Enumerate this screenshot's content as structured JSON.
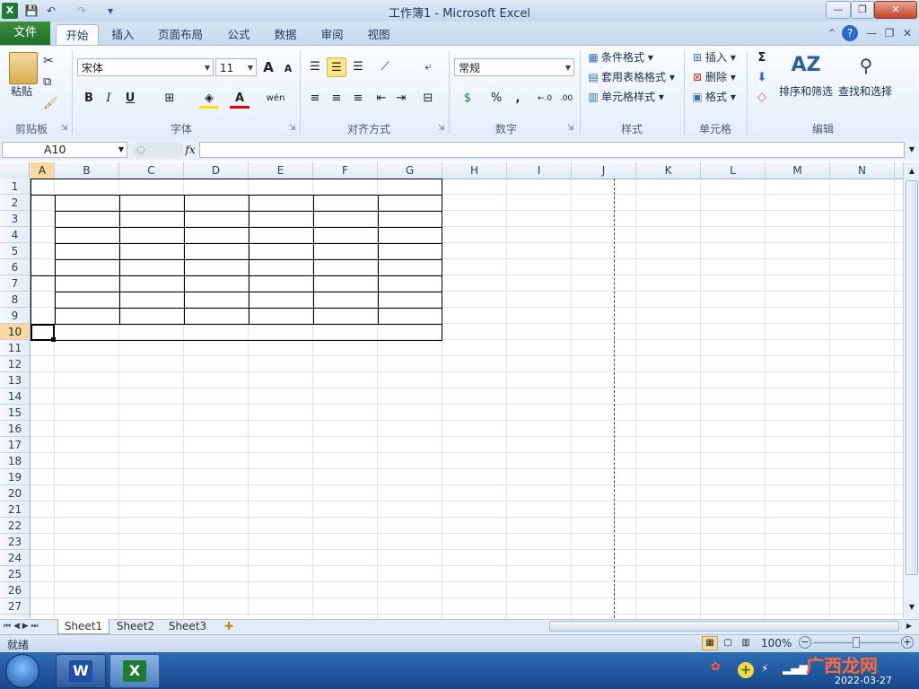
{
  "window": {
    "title": "工作簿1 - Microsoft Excel",
    "buttons": {
      "minimize": "—",
      "restore": "❐",
      "close": "✕"
    }
  },
  "qat": {
    "save": "💾",
    "undo": "↶",
    "redo": "↷",
    "customize": "▾"
  },
  "tabs": {
    "file": "文件",
    "items": [
      "开始",
      "插入",
      "页面布局",
      "公式",
      "数据",
      "审阅",
      "视图"
    ],
    "active": "开始"
  },
  "ribbon": {
    "clipboard": {
      "label": "剪贴板",
      "paste": "粘贴"
    },
    "font": {
      "label": "字体",
      "name": "宋体",
      "size": "11",
      "grow": "A",
      "shrink": "A",
      "bold": "B",
      "italic": "I",
      "underline": "U",
      "wen": "wén"
    },
    "align": {
      "label": "对齐方式"
    },
    "number": {
      "label": "数字",
      "format": "常规",
      "percent": "%",
      "comma": ",",
      "inc": "←.0",
      "dec": ".00"
    },
    "styles": {
      "label": "样式",
      "conditional": "条件格式",
      "table": "套用表格格式",
      "cell": "单元格样式"
    },
    "cells": {
      "label": "单元格",
      "insert": "插入",
      "delete": "删除",
      "format": "格式"
    },
    "editing": {
      "label": "编辑",
      "sort": "排序和筛选",
      "find": "查找和选择",
      "sigma": "Σ"
    }
  },
  "formula_bar": {
    "name_box": "A10",
    "fx": "fx",
    "value": ""
  },
  "grid": {
    "columns": [
      "A",
      "B",
      "C",
      "D",
      "E",
      "F",
      "G",
      "H",
      "I",
      "J",
      "K",
      "L",
      "M",
      "N"
    ],
    "rows": [
      "1",
      "2",
      "3",
      "4",
      "5",
      "6",
      "7",
      "8",
      "9",
      "10",
      "11",
      "12",
      "13",
      "14",
      "15",
      "16",
      "17",
      "18",
      "19",
      "20",
      "21",
      "22",
      "23",
      "24",
      "25",
      "26",
      "27"
    ],
    "selected_cell": "A10",
    "selected_column": "A",
    "selected_row": "10"
  },
  "sheets": {
    "items": [
      "Sheet1",
      "Sheet2",
      "Sheet3"
    ],
    "active": "Sheet1"
  },
  "status": {
    "ready": "就绪",
    "zoom": "100%"
  },
  "taskbar": {
    "date": "2022-03-27",
    "watermark": "广西龙网"
  },
  "colors": {
    "accent_file": "#1e6e27",
    "selection": "#f9d99f",
    "ribbon": "#e3edfa"
  }
}
